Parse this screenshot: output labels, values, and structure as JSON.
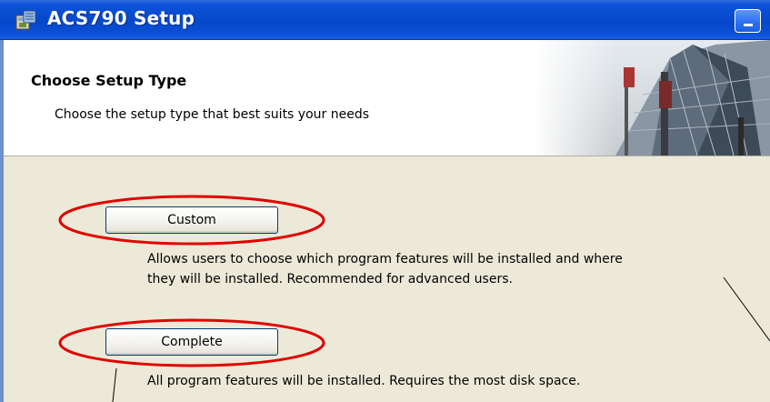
{
  "window": {
    "title": "ACS790 Setup",
    "icon": "setup-installer-icon",
    "minimize_icon": "minimize-icon"
  },
  "banner": {
    "title": "Choose Setup Type",
    "subtitle": "Choose the setup type that best suits your needs",
    "image": "building-photo"
  },
  "options": [
    {
      "label": "Custom",
      "description_lines": [
        "Allows users to choose which program features will be installed and where",
        "they will be installed. Recommended for advanced users."
      ]
    },
    {
      "label": "Complete",
      "description_lines": [
        "All program features will be installed. Requires the most disk space."
      ]
    }
  ],
  "annotations": {
    "highlight_color": "#e00000",
    "highlighted": [
      "Custom",
      "Complete"
    ]
  },
  "colors": {
    "titlebar": "#0647c9",
    "dialog_background": "#ece9d8",
    "desktop": "#6d91c9"
  }
}
